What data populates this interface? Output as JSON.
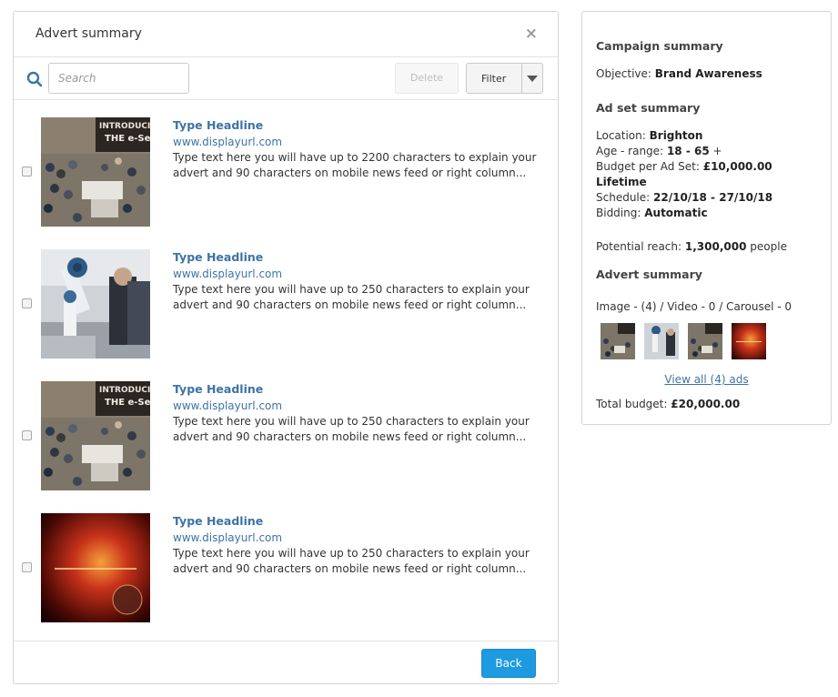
{
  "modal": {
    "title": "Advert summary",
    "close_glyph": "×",
    "search_placeholder": "Search",
    "delete_label": "Delete",
    "filter_label": "Filter",
    "back_label": "Back"
  },
  "ads": [
    {
      "headline": "Type Headline",
      "url": "www.displayurl.com",
      "body": "Type text here you will have up to 2200 characters to explain your advert and 90 characters on mobile news feed or right column...",
      "image": "expo-crowd-image"
    },
    {
      "headline": "Type Headline",
      "url": "www.displayurl.com",
      "body": "Type text here you will have up to 250 characters to explain your advert and 90 characters on mobile news feed or right column...",
      "image": "robot-arm-image"
    },
    {
      "headline": "Type Headline",
      "url": "www.displayurl.com",
      "body": "Type text here you will have up to 250 characters to explain your advert and 90 characters on mobile news feed or right column...",
      "image": "expo-crowd-image"
    },
    {
      "headline": "Type Headline",
      "url": "www.displayurl.com",
      "body": "Type text here you will have up to 250 characters to explain your advert and 90 characters on mobile news feed or right column...",
      "image": "breaking-news-image"
    }
  ],
  "panel": {
    "campaign_heading": "Campaign summary",
    "objective_label": "Objective:",
    "objective_value": "Brand Awareness",
    "adset_heading": "Ad set summary",
    "location_label": "Location:",
    "location_value": "Brighton",
    "age_label": "Age - range:",
    "age_value": "18 - 65",
    "age_suffix": "+",
    "budget_label": "Budget per Ad Set:",
    "budget_value": "£10,000.00",
    "budget_type": "Lifetime",
    "schedule_label": "Schedule:",
    "schedule_value": "22/10/18 - 27/10/18",
    "bidding_label": "Bidding:",
    "bidding_value": "Automatic",
    "reach_label": "Potential reach:",
    "reach_value": "1,300,000",
    "reach_suffix": "people",
    "advert_heading": "Advert summary",
    "format_counts": "Image - (4) / Video - 0 / Carousel - 0",
    "view_all": "View all (4) ads",
    "total_label": "Total budget:",
    "total_value": "£20,000.00"
  },
  "colors": {
    "link": "#3d73a6",
    "primary_button": "#1d9ae0",
    "border": "#d5d5d5"
  },
  "icons": [
    "search-icon",
    "close-icon",
    "chevron-down-icon"
  ]
}
